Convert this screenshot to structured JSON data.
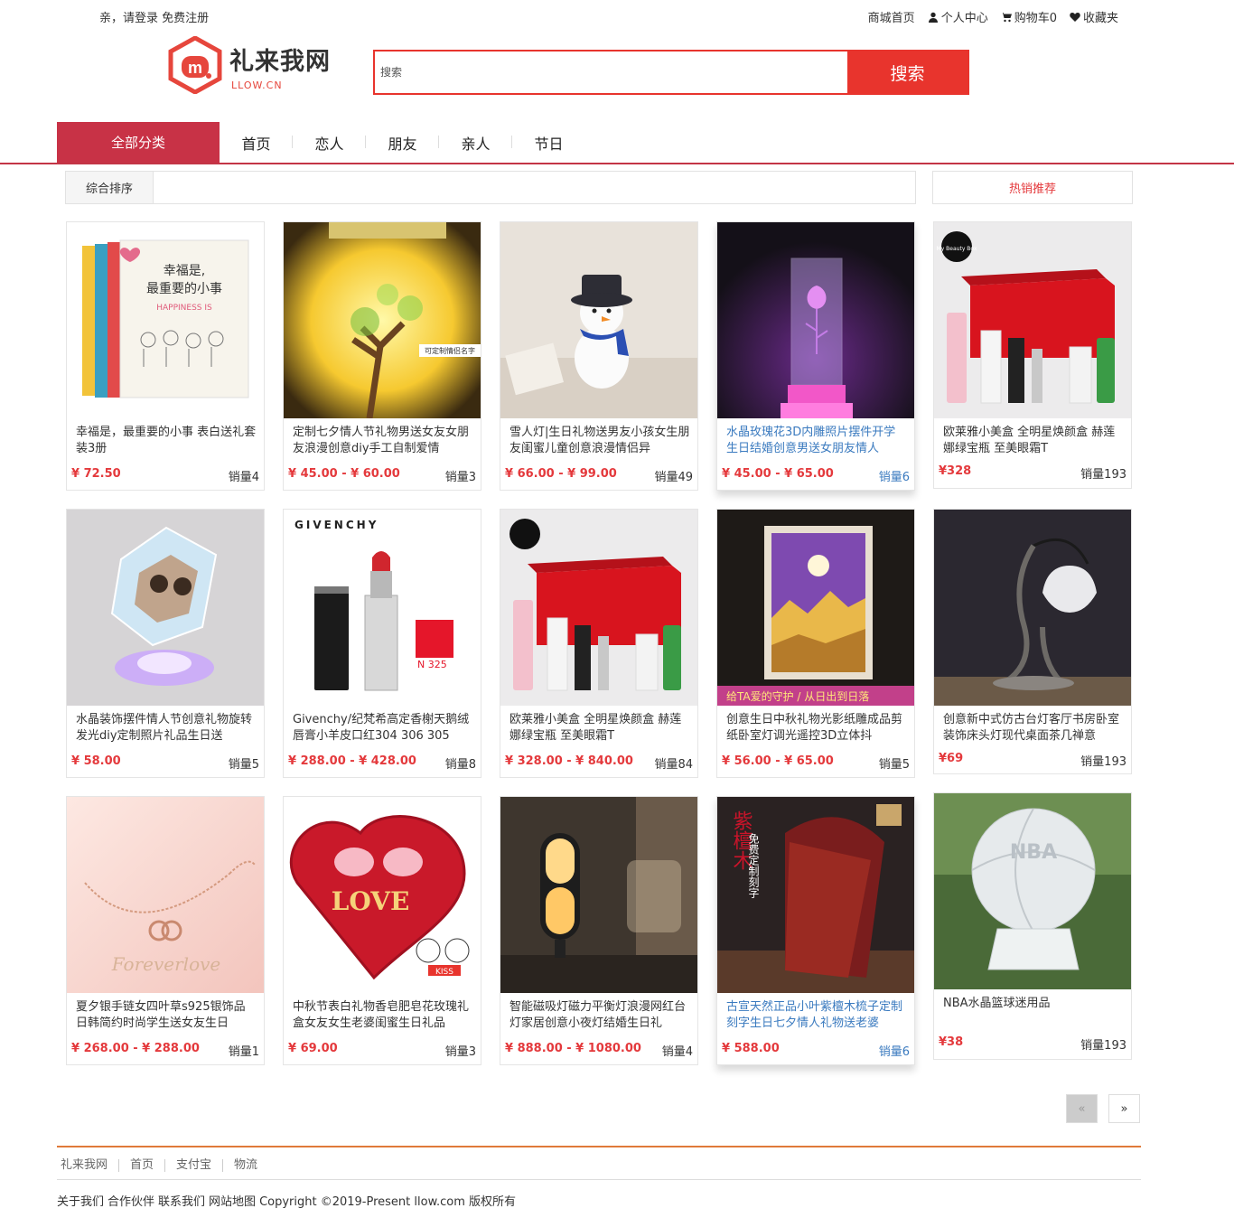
{
  "topbar": {
    "greeting": "亲，请登录",
    "register": "免费注册",
    "links": {
      "home": "商城首页",
      "account": "个人中心",
      "cart": "购物车0",
      "favorites": "收藏夹"
    }
  },
  "logo": {
    "brand": "礼来我网",
    "sub": "LLOW.CN"
  },
  "search": {
    "placeholder": "搜索",
    "button": "搜索"
  },
  "nav": {
    "all_categories": "全部分类",
    "items": [
      "首页",
      "恋人",
      "朋友",
      "亲人",
      "节日"
    ]
  },
  "sort": {
    "label": "综合排序"
  },
  "hot": {
    "label": "热销推荐"
  },
  "products": [
    {
      "title": "幸福是，最重要的小事 表白送礼套装3册",
      "price": "¥ 72.50",
      "sales": "销量4"
    },
    {
      "title": "定制七夕情人节礼物男送女友女朋友浪漫创意diy手工自制爱情",
      "price": "¥ 45.00 - ¥ 60.00",
      "sales": "销量3"
    },
    {
      "title": "雪人灯|生日礼物送男友小孩女生朋友闺蜜儿童创意浪漫情侣异",
      "price": "¥ 66.00 - ¥ 99.00",
      "sales": "销量49"
    },
    {
      "title": "水晶玫瑰花3D内雕照片摆件开学生日结婚创意男送女朋友情人",
      "price": "¥ 45.00 - ¥ 65.00",
      "sales": "销量6"
    },
    {
      "title": "欧莱雅小美盒 全明星焕颜盒 赫莲娜绿宝瓶 至美眼霜T",
      "price": "¥328",
      "sales": "销量193"
    },
    {
      "title": "水晶装饰摆件情人节创意礼物旋转发光diy定制照片礼品生日送",
      "price": "¥ 58.00",
      "sales": "销量5"
    },
    {
      "title": "Givenchy/纪梵希高定香榭天鹅绒唇膏小羊皮口红304 306 305",
      "price": "¥ 288.00 - ¥ 428.00",
      "sales": "销量8"
    },
    {
      "title": "欧莱雅小美盒 全明星焕颜盒 赫莲娜绿宝瓶 至美眼霜T",
      "price": "¥ 328.00 - ¥ 840.00",
      "sales": "销量84"
    },
    {
      "title": "创意生日中秋礼物光影纸雕成品剪纸卧室灯调光遥控3D立体抖",
      "price": "¥ 56.00 - ¥ 65.00",
      "sales": "销量5"
    },
    {
      "title": "创意新中式仿古台灯客厅书房卧室装饰床头灯现代桌面茶几禅意",
      "price": "¥69",
      "sales": "销量193"
    },
    {
      "title": "夏夕银手链女四叶草s925银饰品日韩简约时尚学生送女友生日",
      "price": "¥ 268.00 - ¥ 288.00",
      "sales": "销量1"
    },
    {
      "title": "中秋节表白礼物香皂肥皂花玫瑰礼盒女友女生老婆闺蜜生日礼品",
      "price": "¥ 69.00",
      "sales": "销量3"
    },
    {
      "title": "智能磁吸灯磁力平衡灯浪漫网红台灯家居创意小夜灯结婚生日礼",
      "price": "¥ 888.00 - ¥ 1080.00",
      "sales": "销量4"
    },
    {
      "title": "古宣天然正品小叶紫檀木梳子定制刻字生日七夕情人礼物送老婆",
      "price": "¥ 588.00",
      "sales": "销量6"
    },
    {
      "title": "NBA水晶篮球迷用品",
      "price": "¥38",
      "sales": "销量193"
    }
  ],
  "image_text": {
    "book_line1": "幸福是,",
    "book_line2": "最重要的小事",
    "book_en": "HAPPINESS IS",
    "jar_label": "可定制情侣名字",
    "givenchy": "GIVENCHY",
    "lipstick_code": "N 325",
    "box_badge": "My Beauty Box",
    "paper_caption": "给TA爱的守护 / 从日出到日落",
    "love": "LOVE",
    "kiss": "KISS",
    "forever": "Foreverlove",
    "nba": "NBA",
    "comb_text": "紫檀木",
    "comb_sub": "免费定制刻字"
  },
  "pager": {
    "prev": "«",
    "next": "»"
  },
  "footer": {
    "links": [
      "礼来我网",
      "首页",
      "支付宝",
      "物流"
    ],
    "bottom": [
      "关于我们",
      "合作伙伴",
      "联系我们",
      "网站地图",
      "Copyright ©2019-Present llow.com 版权所有"
    ]
  },
  "colors": {
    "accent": "#e8342d",
    "nav_all": "#c83246",
    "price": "#e4393c",
    "link_highlight": "#3a7abf",
    "footer_line": "#e07a3a"
  }
}
